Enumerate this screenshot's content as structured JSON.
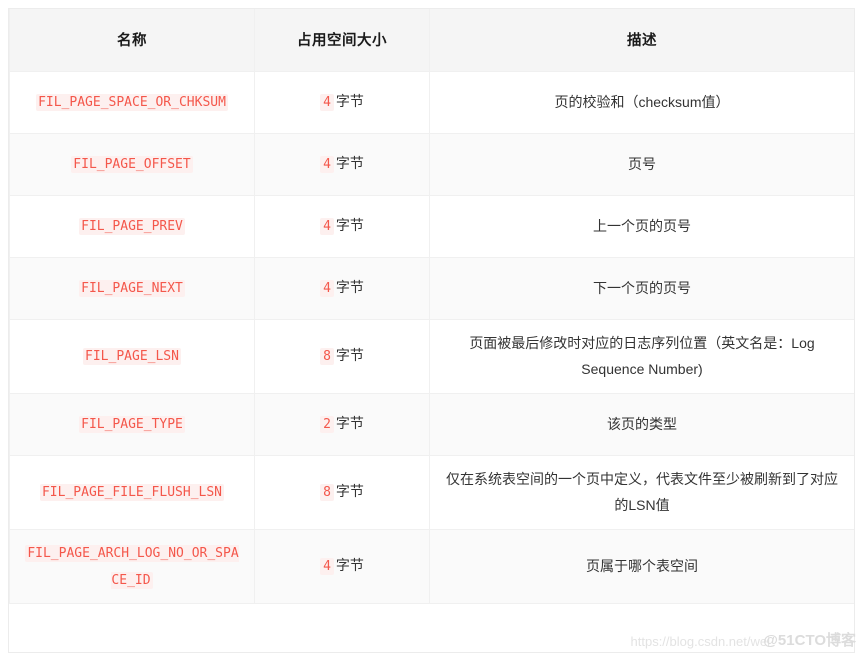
{
  "table": {
    "headers": {
      "name": "名称",
      "size": "占用空间大小",
      "description": "描述"
    },
    "rows": [
      {
        "name": "FIL_PAGE_SPACE_OR_CHKSUM",
        "size_value": "4",
        "size_unit": "字节",
        "description": "页的校验和（checksum值）"
      },
      {
        "name": "FIL_PAGE_OFFSET",
        "size_value": "4",
        "size_unit": "字节",
        "description": "页号"
      },
      {
        "name": "FIL_PAGE_PREV",
        "size_value": "4",
        "size_unit": "字节",
        "description": "上一个页的页号"
      },
      {
        "name": "FIL_PAGE_NEXT",
        "size_value": "4",
        "size_unit": "字节",
        "description": "下一个页的页号"
      },
      {
        "name": "FIL_PAGE_LSN",
        "size_value": "8",
        "size_unit": "字节",
        "description": "页面被最后修改时对应的日志序列位置（英文名是：Log Sequence Number)"
      },
      {
        "name": "FIL_PAGE_TYPE",
        "size_value": "2",
        "size_unit": "字节",
        "description": "该页的类型"
      },
      {
        "name": "FIL_PAGE_FILE_FLUSH_LSN",
        "size_value": "8",
        "size_unit": "字节",
        "description": "仅在系统表空间的一个页中定义，代表文件至少被刷新到了对应的LSN值"
      },
      {
        "name": "FIL_PAGE_ARCH_LOG_NO_OR_SPACE_ID",
        "size_value": "4",
        "size_unit": "字节",
        "description": "页属于哪个表空间"
      }
    ]
  },
  "watermarks": {
    "url": "https://blog.csdn.net/wei",
    "brand": "@51CTO博客"
  },
  "colors": {
    "code_text": "#f4574b",
    "code_background": "#fdf0ef",
    "header_background": "#f5f5f5",
    "row_stripe": "#fafafa",
    "body_text": "#333333",
    "border": "#f0f0f0"
  }
}
